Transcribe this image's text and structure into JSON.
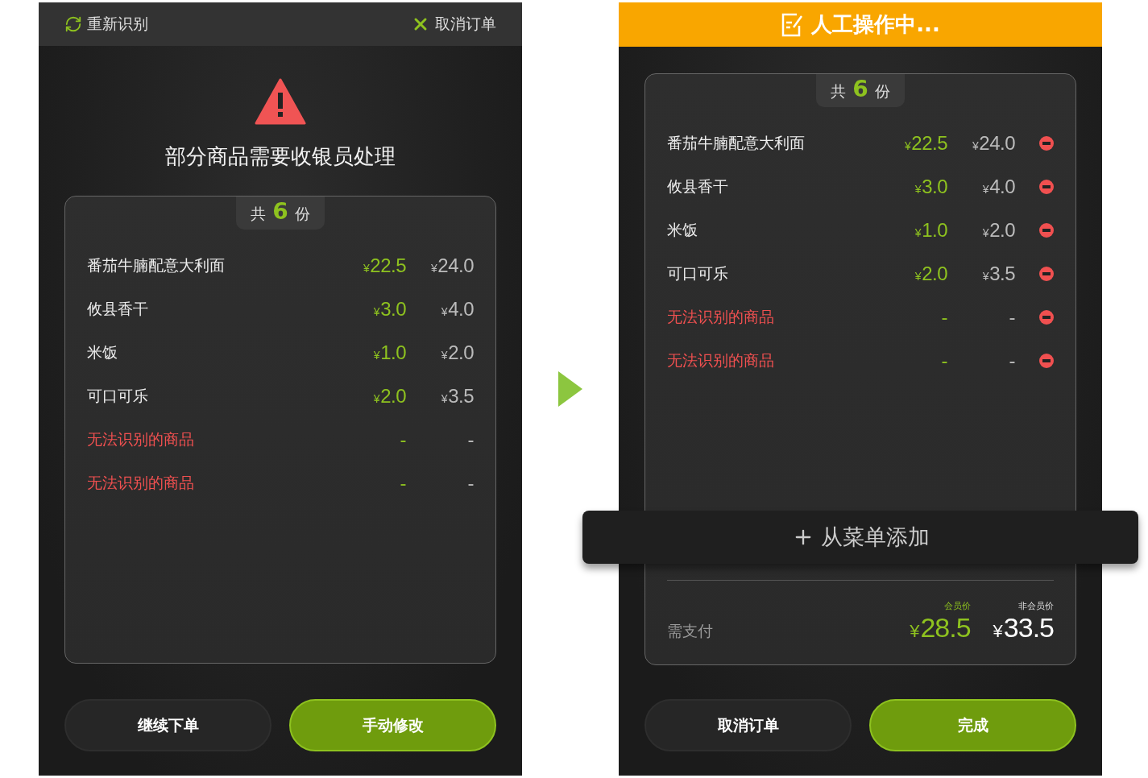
{
  "left_screen": {
    "top_bar": {
      "retry": "重新识别",
      "cancel": "取消订单"
    },
    "alert": "部分商品需要收银员处理",
    "count": {
      "prefix": "共",
      "number": "6",
      "suffix": "份"
    },
    "items": [
      {
        "name": "番茄牛腩配意大利面",
        "member_price": "¥22.5",
        "price": "¥24.0",
        "kind": "recognized"
      },
      {
        "name": "攸县香干",
        "member_price": "¥3.0",
        "price": "¥4.0",
        "kind": "recognized"
      },
      {
        "name": "米饭",
        "member_price": "¥1.0",
        "price": "¥2.0",
        "kind": "recognized"
      },
      {
        "name": "可口可乐",
        "member_price": "¥2.0",
        "price": "¥3.5",
        "kind": "recognized"
      },
      {
        "name": "无法识别的商品",
        "member_price": "-",
        "price": "-",
        "kind": "unrecognized"
      },
      {
        "name": "无法识别的商品",
        "member_price": "-",
        "price": "-",
        "kind": "unrecognized"
      }
    ],
    "buttons": [
      {
        "label": "继续下单",
        "kind": "secondary"
      },
      {
        "label": "手动修改",
        "kind": "primary"
      }
    ]
  },
  "right_screen": {
    "banner": "人工操作中...",
    "count": {
      "prefix": "共",
      "number": "6",
      "suffix": "份"
    },
    "items": [
      {
        "name": "番茄牛腩配意大利面",
        "member_price": "¥22.5",
        "price": "¥24.0",
        "kind": "recognized"
      },
      {
        "name": "攸县香干",
        "member_price": "¥3.0",
        "price": "¥4.0",
        "kind": "recognized"
      },
      {
        "name": "米饭",
        "member_price": "¥1.0",
        "price": "¥2.0",
        "kind": "recognized"
      },
      {
        "name": "可口可乐",
        "member_price": "¥2.0",
        "price": "¥3.5",
        "kind": "recognized"
      },
      {
        "name": "无法识别的商品",
        "member_price": "-",
        "price": "-",
        "kind": "unrecognized"
      },
      {
        "name": "无法识别的商品",
        "member_price": "-",
        "price": "-",
        "kind": "unrecognized"
      }
    ],
    "add_button": "从菜单添加",
    "total": {
      "label": "需支付",
      "member_label": "会员价",
      "member_amount": "¥28.5",
      "regular_label": "非会员价",
      "regular_amount": "¥33.5"
    },
    "buttons": [
      {
        "label": "取消订单",
        "kind": "secondary"
      },
      {
        "label": "完成",
        "kind": "primary"
      }
    ]
  }
}
